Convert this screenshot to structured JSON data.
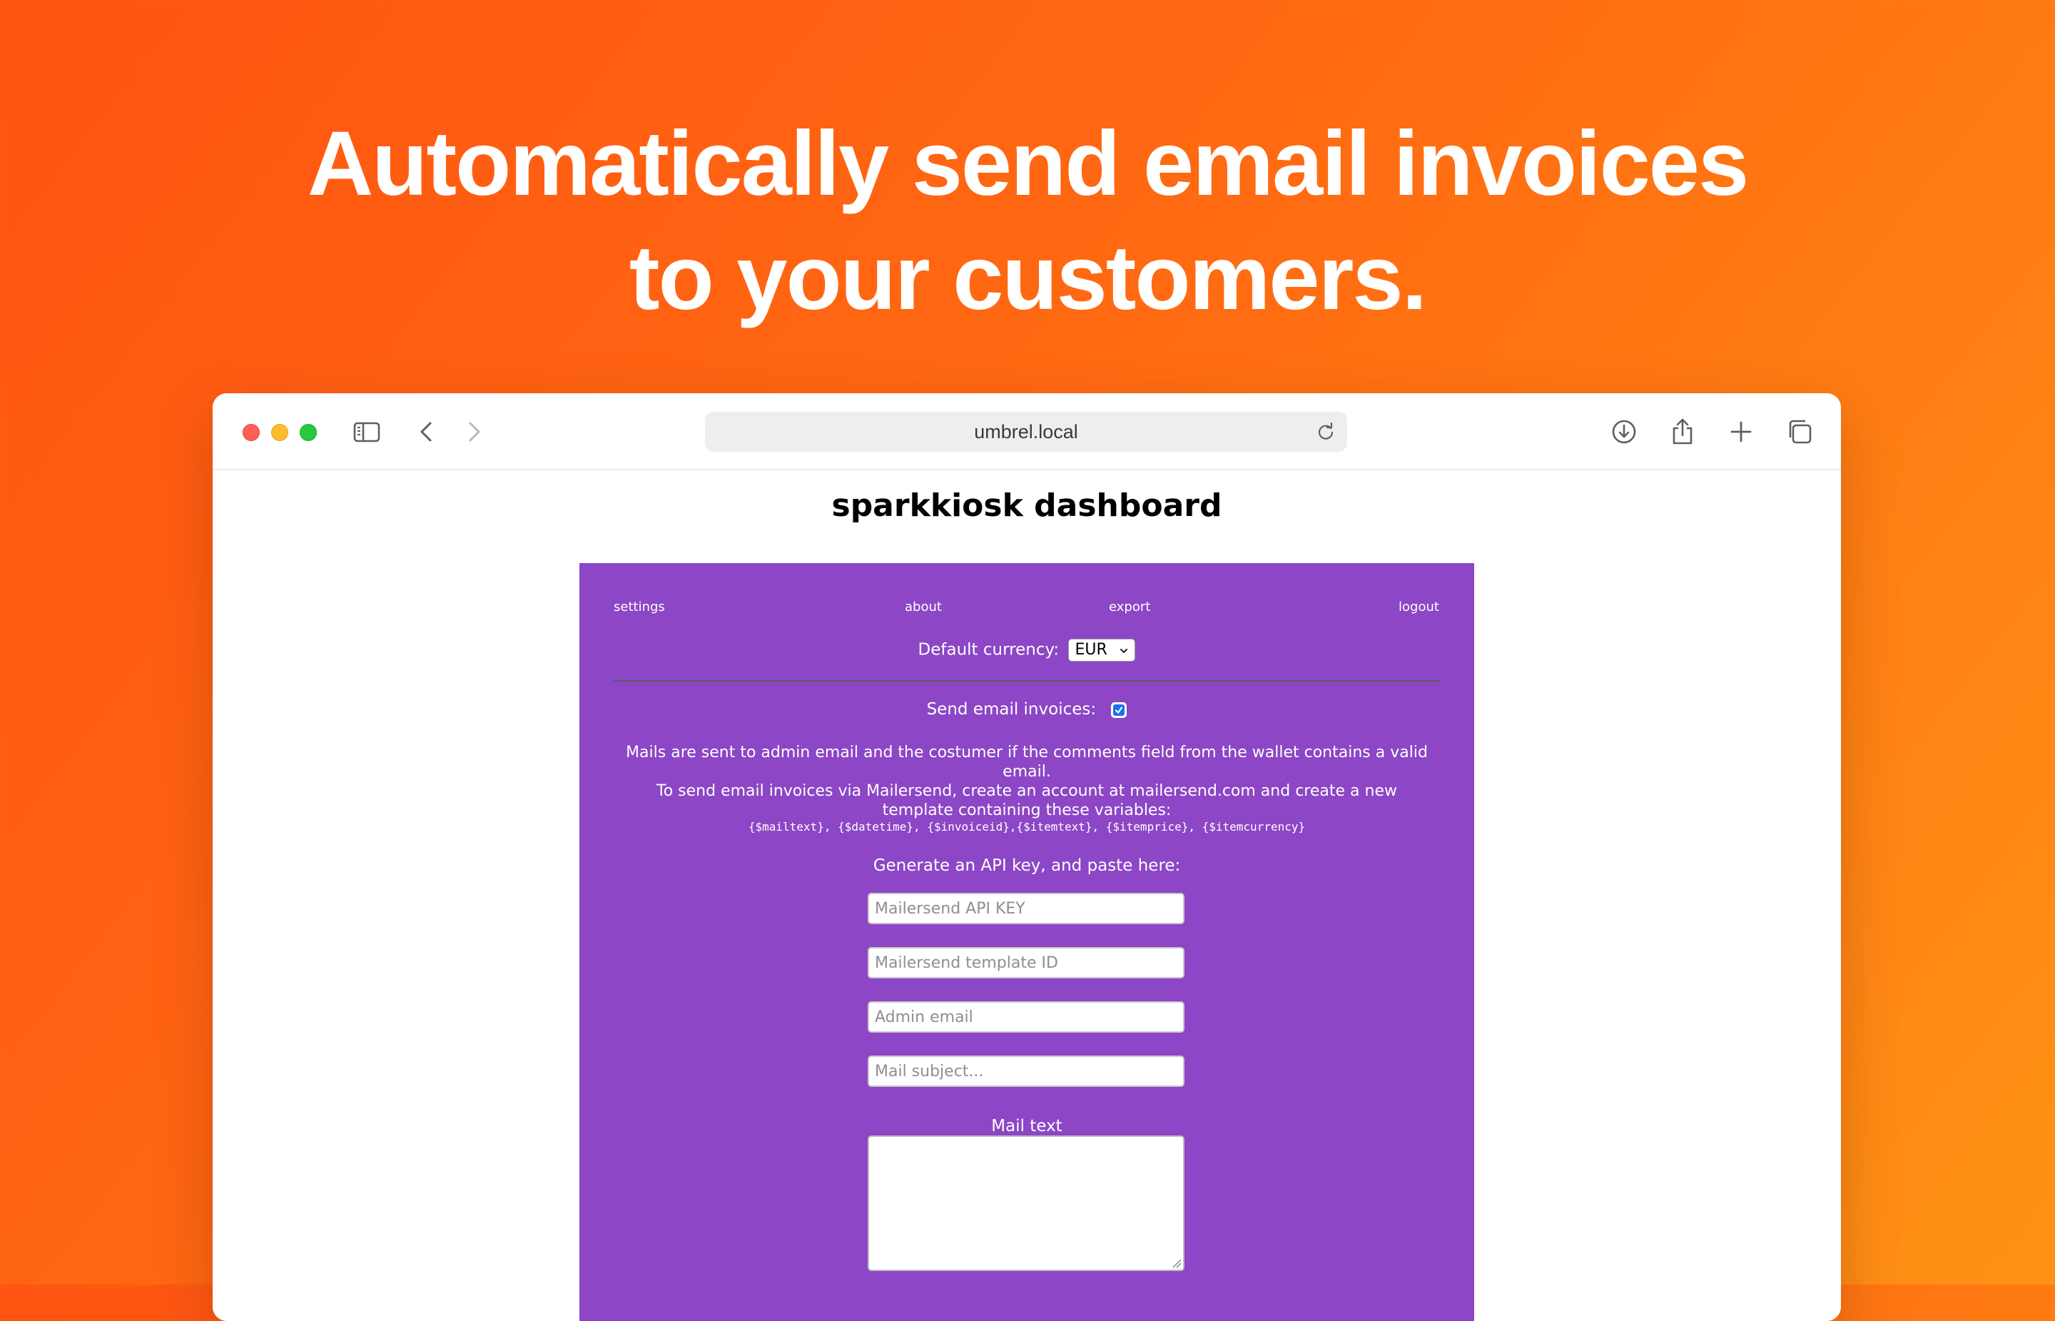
{
  "headline": {
    "line1": "Automatically send email invoices",
    "line2": "to your customers."
  },
  "browser": {
    "url": "umbrel.local",
    "toolbar_icons": [
      "sidebar-icon",
      "back-icon",
      "forward-icon",
      "reload-icon",
      "download-icon",
      "share-icon",
      "new-tab-icon",
      "tabs-overview-icon"
    ]
  },
  "page": {
    "title": "sparkkiosk dashboard",
    "nav": {
      "settings": "settings",
      "about": "about",
      "export": "export",
      "logout": "logout"
    },
    "currency": {
      "label": "Default currency:",
      "selected": "EUR"
    },
    "email": {
      "toggle_label": "Send email invoices:",
      "enabled": true,
      "info_line1": "Mails are sent to admin email and the costumer if the comments field from the wallet contains a valid email.",
      "info_line2": "To send email invoices via Mailersend, create an account at mailersend.com and create a new template containing these variables:",
      "variables": "{$mailtext}, {$datetime}, {$invoiceid},{$itemtext}, {$itemprice}, {$itemcurrency}",
      "api_label": "Generate an API key, and paste here:",
      "api_key_placeholder": "Mailersend API KEY",
      "template_id_placeholder": "Mailersend template ID",
      "admin_email_placeholder": "Admin email",
      "subject_placeholder": "Mail subject...",
      "mail_text_label": "Mail text",
      "mail_text_value": ""
    }
  },
  "colors": {
    "background_start": "#ff5412",
    "background_end": "#ff9215",
    "panel": "#8c46c6",
    "checkbox_accent": "#1a73e8"
  }
}
